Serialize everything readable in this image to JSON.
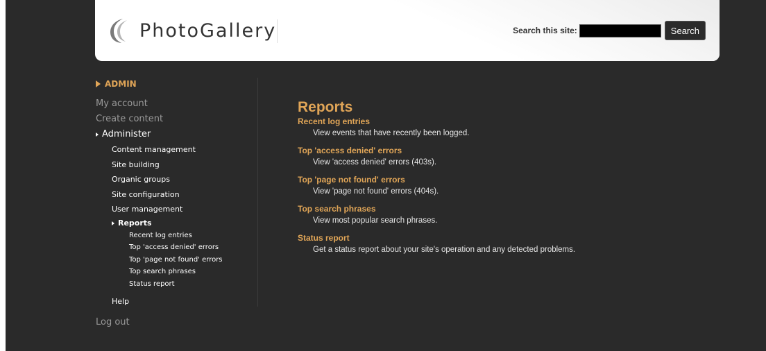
{
  "header": {
    "logo_text": "PhotoGallery",
    "logo_icon": "crescent-logo-icon",
    "search_label": "Search this site:",
    "search_value": "",
    "search_button": "Search"
  },
  "sidebar": {
    "heading": "ADMIN",
    "top_items": [
      "My account",
      "Create content"
    ],
    "administer": {
      "label": "Administer",
      "items": [
        "Content management",
        "Site building",
        "Organic groups",
        "Site configuration",
        "User management"
      ],
      "reports": {
        "label": "Reports",
        "items": [
          "Recent log entries",
          "Top 'access denied' errors",
          "Top 'page not found' errors",
          "Top search phrases",
          "Status report"
        ]
      },
      "help": "Help"
    },
    "logout": "Log out"
  },
  "main": {
    "title": "Reports",
    "reports": [
      {
        "title": "Recent log entries",
        "description": "View events that have recently been logged."
      },
      {
        "title": "Top 'access denied' errors",
        "description": "View 'access denied' errors (403s)."
      },
      {
        "title": "Top 'page not found' errors",
        "description": "View 'page not found' errors (404s)."
      },
      {
        "title": "Top search phrases",
        "description": "View most popular search phrases."
      },
      {
        "title": "Status report",
        "description": "Get a status report about your site's operation and any detected problems."
      }
    ]
  },
  "colors": {
    "background": "#2a2a2a",
    "accent": "#e0a557",
    "muted_text": "#9a9a9a",
    "text": "#ffffff"
  }
}
